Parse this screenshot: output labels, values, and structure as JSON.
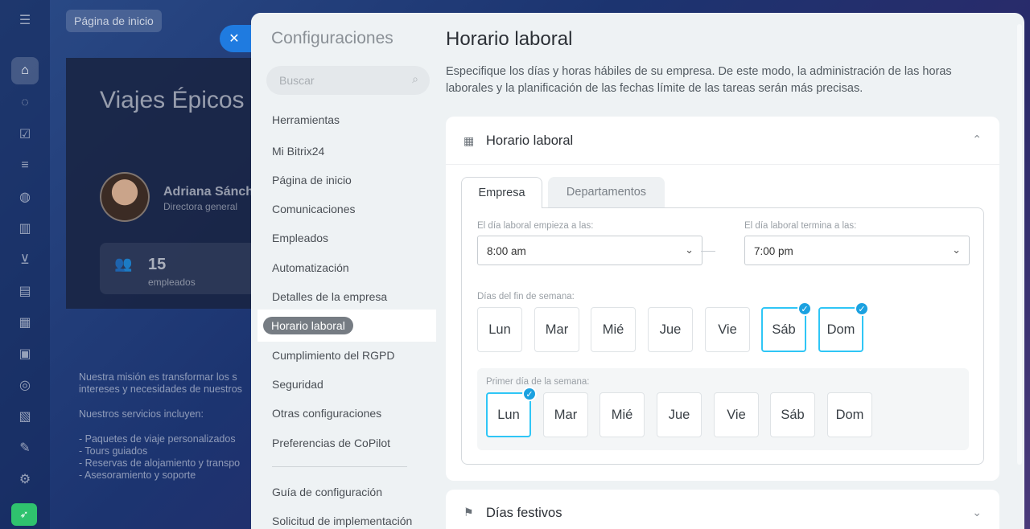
{
  "background": {
    "breadcrumb_chip": "Página de inicio",
    "company_title": "Viajes Épicos",
    "person_name": "Adriana Sánch",
    "person_role": "Directora general",
    "stat_number": "15",
    "stat_label": "empleados",
    "text_lines": [
      "Nuestra misión es transformar los s",
      "intereses y necesidades de nuestros",
      "Nuestros servicios incluyen:",
      "- Paquetes de viaje personalizados",
      "- Tours guiados",
      "- Reservas de alojamiento y transpo",
      "- Asesoramiento y soporte"
    ]
  },
  "sidebar": {
    "title": "Configuraciones",
    "search_placeholder": "Buscar",
    "items": [
      "Herramientas",
      "Mi Bitrix24",
      "Página de inicio",
      "Comunicaciones",
      "Empleados",
      "Automatización",
      "Detalles de la empresa",
      "Horario laboral",
      "Cumplimiento del RGPD",
      "Seguridad",
      "Otras configuraciones",
      "Preferencias de CoPilot"
    ],
    "footer_items": [
      "Guía de configuración",
      "Solicitud de implementación"
    ]
  },
  "main": {
    "title": "Horario laboral",
    "description": "Especifique los días y horas hábiles de su empresa. De este modo, la administración de las horas laborales y la planificación de las fechas límite de las tareas serán más precisas.",
    "panel": {
      "title": "Horario laboral",
      "tabs": [
        "Empresa",
        "Departamentos"
      ],
      "start_label": "El día laboral empieza a las:",
      "start_value": "8:00 am",
      "end_label": "El día laboral termina a las:",
      "end_value": "7:00 pm",
      "weekend_label": "Días del fin de semana:",
      "weekend_days": [
        "Lun",
        "Mar",
        "Mié",
        "Jue",
        "Vie",
        "Sáb",
        "Dom"
      ],
      "first_day_label": "Primer día de la semana:",
      "first_days": [
        "Lun",
        "Mar",
        "Mié",
        "Jue",
        "Vie",
        "Sáb",
        "Dom"
      ]
    },
    "panel2": {
      "title": "Días festivos"
    }
  },
  "colors": {
    "accent_blue": "#1f7be0",
    "selected_border": "#2fc6f6",
    "check_badge": "#1ba1e0",
    "active_item_bg": "#767c83"
  }
}
